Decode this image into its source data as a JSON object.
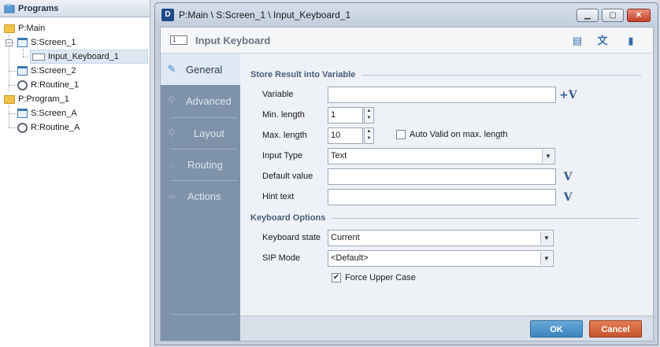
{
  "tree": {
    "header": "Programs",
    "items": [
      {
        "label": "P:Main",
        "icon": "folder-icon"
      },
      {
        "label": "S:Screen_1",
        "icon": "screen-icon"
      },
      {
        "label": "Input_Keyboard_1",
        "icon": "keyboard-icon"
      },
      {
        "label": "S:Screen_2",
        "icon": "screen-icon"
      },
      {
        "label": "R:Routine_1",
        "icon": "gear-icon"
      },
      {
        "label": "P:Program_1",
        "icon": "folder-icon"
      },
      {
        "label": "S:Screen_A",
        "icon": "screen-icon"
      },
      {
        "label": "R:Routine_A",
        "icon": "gear-icon"
      }
    ]
  },
  "dialog": {
    "app_icon": "D",
    "title": "P:Main \\ S:Screen_1 \\ Input_Keyboard_1",
    "header_title": "Input Keyboard",
    "header_icon_text": "1"
  },
  "nav": {
    "items": [
      {
        "label": "General",
        "icon": "general-icon",
        "active": true
      },
      {
        "label": "Advanced",
        "icon": "advanced-icon",
        "active": false
      },
      {
        "label": "Layout",
        "icon": "layout-icon",
        "active": false
      },
      {
        "label": "Routing",
        "icon": "routing-icon",
        "active": false
      },
      {
        "label": "Actions",
        "icon": "actions-icon",
        "active": false
      }
    ]
  },
  "store": {
    "section_title": "Store Result into Variable",
    "variable_label": "Variable",
    "variable_value": "",
    "variable_button": "+V",
    "min_label": "Min. length",
    "min_value": "1",
    "max_label": "Max. length",
    "max_value": "10",
    "auto_valid_label": "Auto Valid on max. length",
    "auto_valid_checked": false,
    "input_type_label": "Input Type",
    "input_type_value": "Text",
    "default_label": "Default value",
    "default_value": "",
    "hint_label": "Hint text",
    "hint_value": "",
    "v_button": "V"
  },
  "keyboard": {
    "section_title": "Keyboard Options",
    "state_label": "Keyboard state",
    "state_value": "Current",
    "sip_label": "SIP Mode",
    "sip_value": "<Default>",
    "force_upper_label": "Force Upper Case",
    "force_upper_checked": true
  },
  "footer": {
    "ok": "OK",
    "cancel": "Cancel"
  },
  "colors": {
    "ok": "#3c84bd",
    "cancel": "#c5542c",
    "nav_bg": "#7e93aa",
    "nav_active": "#dfe9f5"
  }
}
